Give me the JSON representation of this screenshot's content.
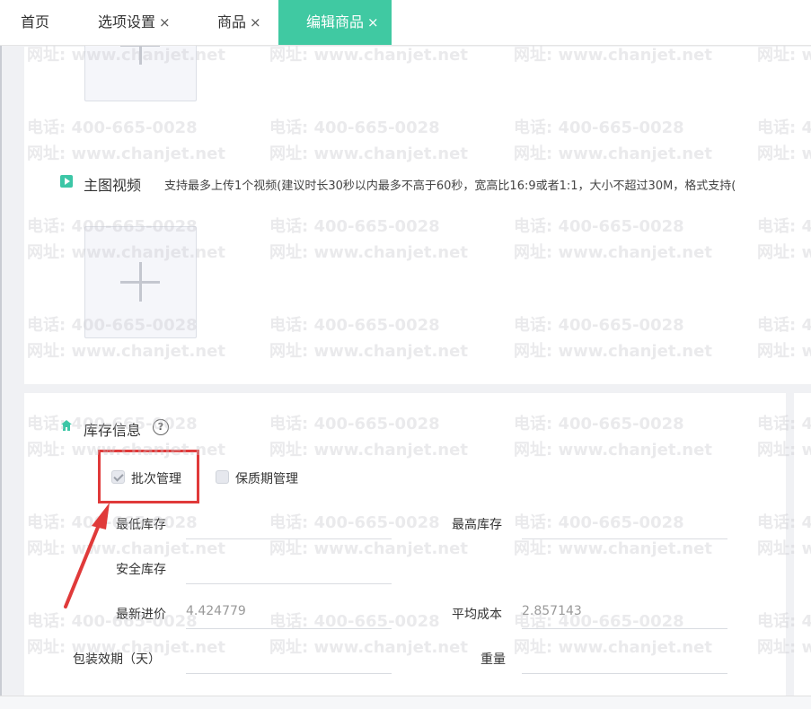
{
  "tabs": [
    {
      "label": "首页",
      "closable": false
    },
    {
      "label": "选项设置",
      "closable": true
    },
    {
      "label": "商品",
      "closable": true
    },
    {
      "label": "编辑商品",
      "closable": true,
      "active": true
    }
  ],
  "tab_close_glyph": "×",
  "media": {
    "video_title": "主图视频",
    "video_hint": "支持最多上传1个视频(建议时长30秒以内最多不高于60秒，宽高比16:9或者1:1，大小不超过30M，格式支持("
  },
  "inventory": {
    "title": "库存信息",
    "help_glyph": "?",
    "batch_label": "批次管理",
    "batch_checked": true,
    "shelf_label": "保质期管理",
    "shelf_checked": false,
    "min_stock_label": "最低库存",
    "max_stock_label": "最高库存",
    "safety_stock_label": "安全库存",
    "latest_price_label": "最新进价",
    "latest_price_value": "4.424779",
    "avg_cost_label": "平均成本",
    "avg_cost_value": "2.857143",
    "shelf_life_label": "包装效期（天）",
    "weight_label": "重量"
  },
  "watermark": {
    "phone": "电话: 400-665-0028",
    "site": "网址: www.chanjet.net"
  },
  "colors": {
    "accent": "#40c9a2",
    "annotation": "#e03a3a"
  },
  "icons": [
    "close-icon",
    "video-icon",
    "plus-icon",
    "house-icon",
    "help-icon",
    "checkmark-icon",
    "arrow-icon"
  ]
}
